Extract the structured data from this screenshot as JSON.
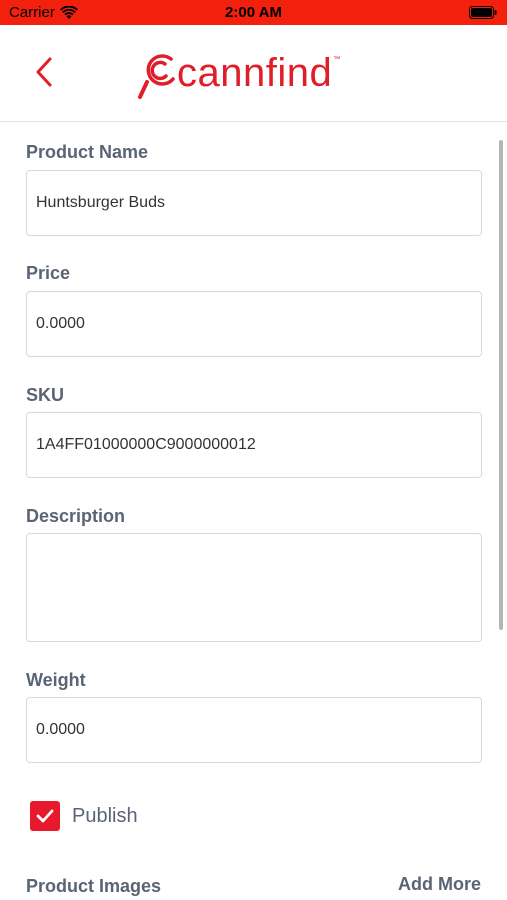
{
  "status_bar": {
    "carrier": "Carrier",
    "time": "2:00 AM"
  },
  "header": {
    "logo_text": "cannfind",
    "logo_tm": "™"
  },
  "form": {
    "product_name": {
      "label": "Product Name",
      "value": "Huntsburger Buds"
    },
    "price": {
      "label": "Price",
      "value": "0.0000"
    },
    "sku": {
      "label": "SKU",
      "value": "1A4FF01000000C9000000012"
    },
    "description": {
      "label": "Description",
      "value": ""
    },
    "weight": {
      "label": "Weight",
      "value": "0.0000"
    },
    "publish": {
      "label": "Publish",
      "checked": true
    }
  },
  "product_images": {
    "label": "Product Images",
    "add_more": "Add More"
  },
  "colors": {
    "status_bar": "#f2200c",
    "brand": "#e01e2a",
    "label": "#5a6475"
  }
}
